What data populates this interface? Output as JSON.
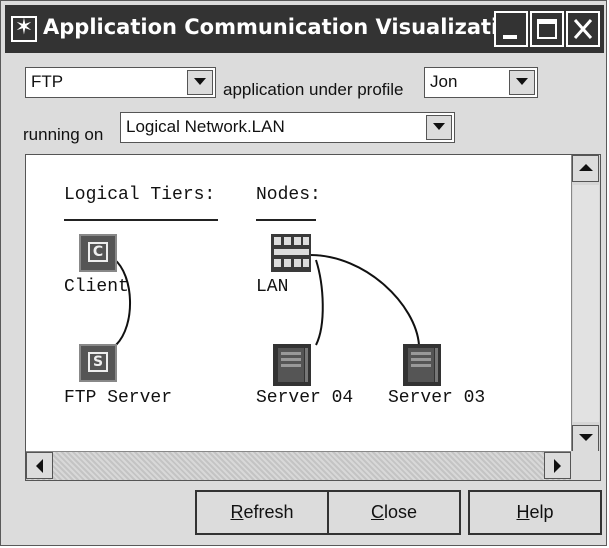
{
  "window": {
    "title": "Application Communication Visualization",
    "caption_buttons": [
      "minimize-icon",
      "maximize-icon",
      "close-icon"
    ]
  },
  "profile_bar": {
    "application_value": "FTP",
    "under_profile_label": "application under profile",
    "profile_value": "Jon",
    "running_on_label": "running on",
    "network_value": "Logical Network.LAN"
  },
  "diagram": {
    "tiers_header": "Logical Tiers:",
    "nodes_header": "Nodes:",
    "tiers": [
      {
        "label": "Client",
        "icon_letter": "C"
      },
      {
        "label": "FTP Server",
        "icon_letter": "S"
      }
    ],
    "nodes": [
      {
        "label": "LAN",
        "icon": "lan-switch-icon"
      },
      {
        "label": "Server 04",
        "icon": "server-icon"
      },
      {
        "label": "Server 03",
        "icon": "server-icon"
      }
    ]
  },
  "buttons": {
    "refresh": {
      "mnemonic": "R",
      "rest": "efresh"
    },
    "close": {
      "mnemonic": "C",
      "rest": "lose"
    },
    "help": {
      "mnemonic": "H",
      "rest": "elp"
    }
  }
}
